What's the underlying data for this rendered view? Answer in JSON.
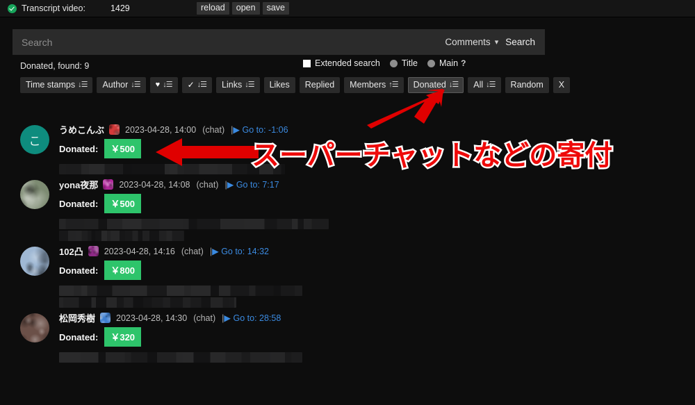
{
  "header": {
    "status_icon": "check-circle-icon",
    "label": "Transcript video:",
    "count": "1429",
    "buttons": [
      {
        "name": "reload",
        "label": "reload"
      },
      {
        "name": "open",
        "label": "open"
      },
      {
        "name": "save",
        "label": "save"
      }
    ]
  },
  "search": {
    "placeholder": "Search",
    "value": "",
    "scope": "Comments",
    "caret": "⌄",
    "submit_label": "Search"
  },
  "options": {
    "found_text": "Donated, found: 9",
    "extended_search_label": "Extended search",
    "extended_search_checked": true,
    "title_label": "Title",
    "main_label": "Main",
    "help": "?"
  },
  "sort_buttons": [
    {
      "name": "time-stamps",
      "label": "Time stamps",
      "dir": "↓",
      "active": false,
      "icon": null
    },
    {
      "name": "author",
      "label": "Author",
      "dir": "↓",
      "active": false,
      "icon": null
    },
    {
      "name": "likes-heart",
      "label": "",
      "dir": "↓",
      "active": false,
      "icon": "heart-icon"
    },
    {
      "name": "checked",
      "label": "",
      "dir": "↓",
      "active": false,
      "icon": "check-icon"
    },
    {
      "name": "links",
      "label": "Links",
      "dir": "↓",
      "active": false,
      "icon": null
    },
    {
      "name": "likes",
      "label": "Likes",
      "dir": "",
      "active": false,
      "icon": null
    },
    {
      "name": "replied",
      "label": "Replied",
      "dir": "",
      "active": false,
      "icon": null
    },
    {
      "name": "members",
      "label": "Members",
      "dir": "↑",
      "active": false,
      "icon": null
    },
    {
      "name": "donated",
      "label": "Donated",
      "dir": "↓",
      "active": true,
      "icon": null
    },
    {
      "name": "all",
      "label": "All",
      "dir": "↓",
      "active": false,
      "icon": null
    },
    {
      "name": "random",
      "label": "Random",
      "dir": "",
      "active": false,
      "icon": null
    },
    {
      "name": "clear",
      "label": "X",
      "dir": "",
      "active": false,
      "icon": null
    }
  ],
  "comments": [
    {
      "username": "うめこんぶ",
      "avatar_text": "こ",
      "avatar_color": "#0e8c7e",
      "avatar_type": "letter",
      "badge_color": "#d33a3a",
      "date": "2023-04-28, 14:00",
      "type": "(chat)",
      "goto_label": "Go to:",
      "goto_time": "-1:06",
      "donated_label": "Donated:",
      "donated_amount": "￥500",
      "blur_widths": [
        325,
        0
      ]
    },
    {
      "username": "yona夜那",
      "avatar_text": "",
      "avatar_color": "#7d8b72",
      "avatar_type": "image",
      "badge_color": "#b0279b",
      "date": "2023-04-28, 14:08",
      "type": "(chat)",
      "goto_label": "Go to:",
      "goto_time": "7:17",
      "donated_label": "Donated:",
      "donated_amount": "￥500",
      "blur_widths": [
        388,
        180
      ]
    },
    {
      "username": "102凸",
      "avatar_text": "",
      "avatar_color": "#9fb8d4",
      "avatar_type": "image",
      "badge_color": "#8e2a86",
      "date": "2023-04-28, 14:16",
      "type": "(chat)",
      "goto_label": "Go to:",
      "goto_time": "14:32",
      "donated_label": "Donated:",
      "donated_amount": "￥800",
      "blur_widths": [
        350,
        255
      ]
    },
    {
      "username": "松岡秀樹",
      "avatar_text": "",
      "avatar_color": "#6b5048",
      "avatar_type": "image",
      "badge_color": "#3f7fd0",
      "date": "2023-04-28, 14:30",
      "type": "(chat)",
      "goto_label": "Go to:",
      "goto_time": "28:58",
      "donated_label": "Donated:",
      "donated_amount": "￥320",
      "blur_widths": [
        350,
        0
      ]
    }
  ],
  "annotations": {
    "callout_text": "スーパーチャットなどの寄付",
    "callout_color": "#ee0a0a",
    "arrow_color": "#e00000",
    "arrow_to_donated_button": "points-up-left-to-donated-sort-button",
    "arrow_to_donated_amount": "points-left-to-donated-amount-badge"
  }
}
